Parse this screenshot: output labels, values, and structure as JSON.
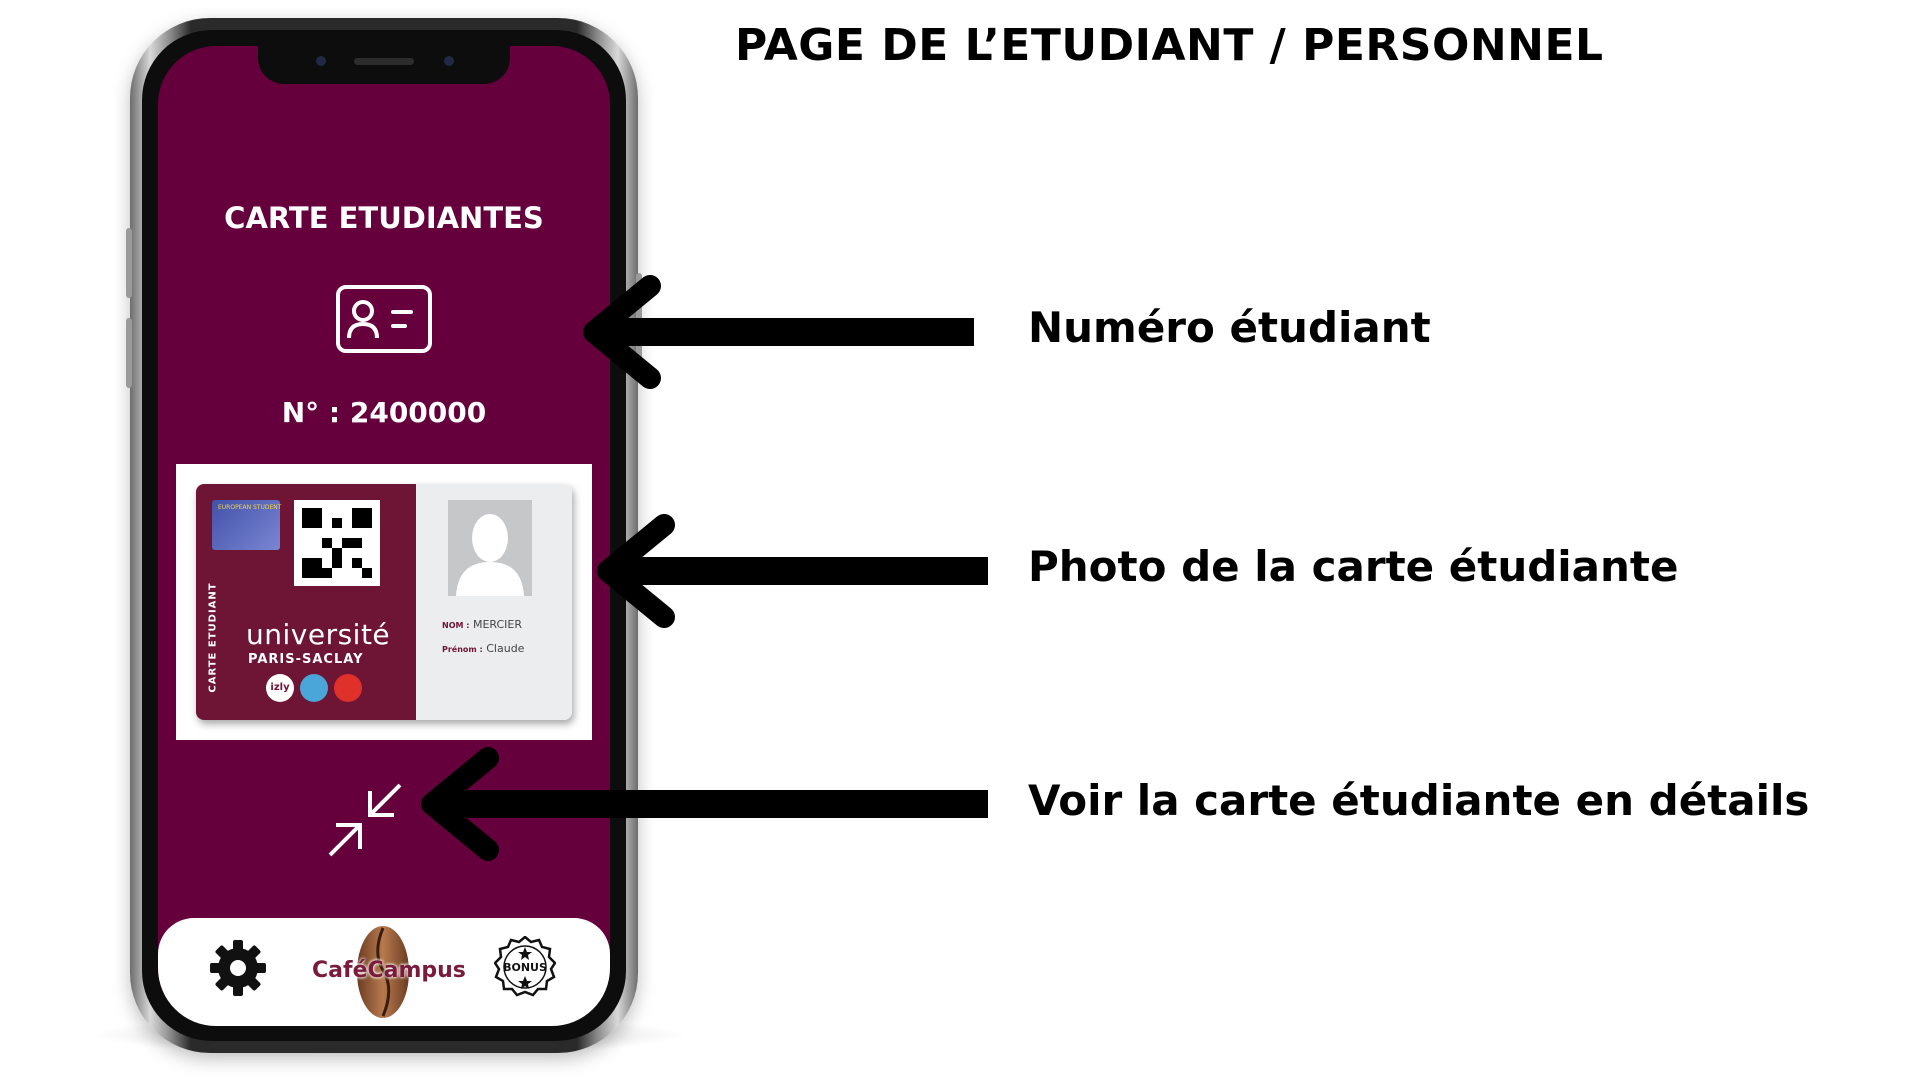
{
  "page_title": "PAGE DE L’ETUDIANT / PERSONNEL",
  "app": {
    "screen_title": "CARTE ETUDIANTES",
    "student_number": "N° : 2400000",
    "card": {
      "vertical_label": "CARTE ETUDIANT",
      "eu_label": "EUROPEAN STUDENT",
      "university_name": "université",
      "university_sub": "PARIS-SACLAY",
      "nom_label": "NOM :",
      "nom_value": "MERCIER",
      "prenom_label": "Prénom :",
      "prenom_value": "Claude",
      "partner_logo_text": "izly"
    },
    "bottom_nav": {
      "brand_cafe": "Café",
      "brand_campus": "Campus",
      "bonus_label": "BONUS"
    }
  },
  "annotations": {
    "student_number": "Numéro étudiant",
    "card_photo": "Photo de la carte étudiante",
    "details": "Voir la carte étudiante en détails"
  },
  "colors": {
    "screen_background": "#65003c",
    "card_burgundy": "#6e1434",
    "brand_text": "#7a1b3c"
  },
  "icons": [
    "id-card-icon",
    "expand-arrows-icon",
    "gear-icon",
    "coffee-bean-icon",
    "bonus-badge-icon",
    "arrow-left-icon"
  ]
}
